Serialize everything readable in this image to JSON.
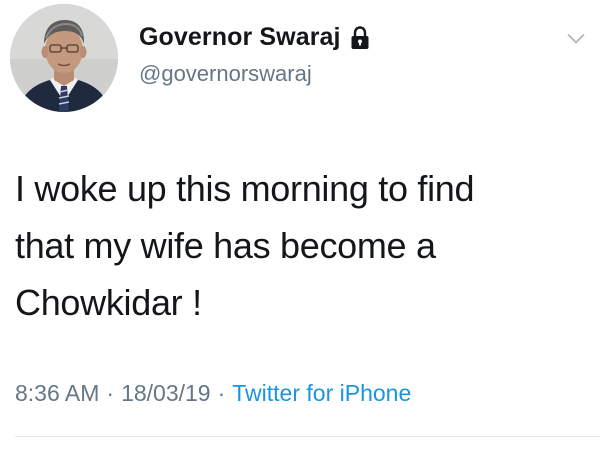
{
  "tweet": {
    "author": {
      "display_name": "Governor Swaraj",
      "handle": "@governorswaraj",
      "protected_icon": "lock-icon",
      "avatar": "profile-photo"
    },
    "menu_icon": "chevron-down-icon",
    "text_lines": [
      "I woke up this morning to find",
      "that my wife has become a",
      "Chowkidar !"
    ],
    "meta": {
      "time": "8:36 AM",
      "separator": "·",
      "date": "18/03/19",
      "source": "Twitter for iPhone"
    }
  },
  "colors": {
    "text_primary": "#14171a",
    "text_secondary": "#657786",
    "link_blue": "#1b95e0",
    "divider": "#e1e8ed"
  }
}
